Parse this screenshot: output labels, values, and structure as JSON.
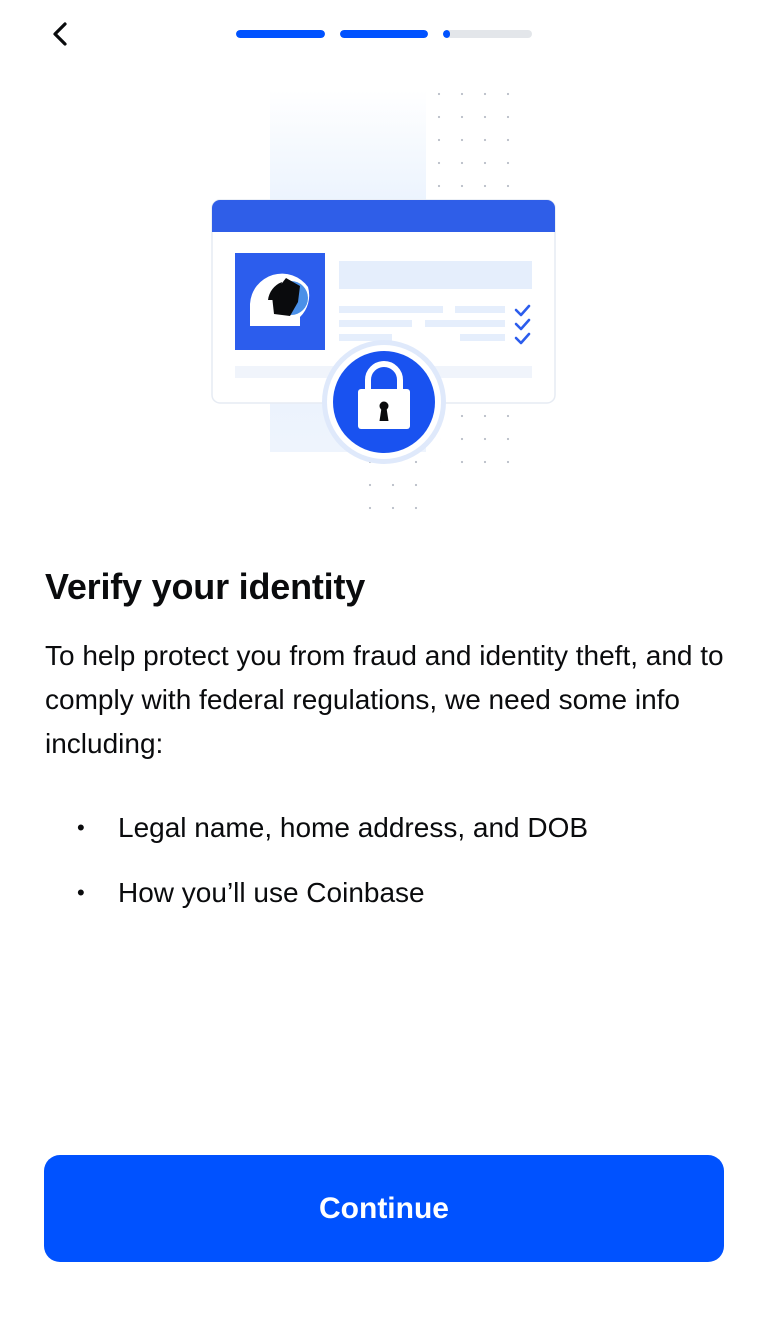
{
  "header": {
    "back_icon": "chevron-left-icon",
    "progress": [
      {
        "step": 1,
        "fill": 1.0
      },
      {
        "step": 2,
        "fill": 1.0
      },
      {
        "step": 3,
        "fill": 0.08
      }
    ]
  },
  "illustration": {
    "icons": [
      "id-card-icon",
      "profile-avatar-icon",
      "checkmark-icon",
      "padlock-icon"
    ],
    "colors": {
      "accent": "#0052ff",
      "light": "#e6f0fd",
      "ring": "#dfe9fb"
    }
  },
  "main": {
    "title": "Verify your identity",
    "description": "To help protect you from fraud and identity theft, and to comply with federal regulations, we need some info including:",
    "requirements": [
      "Legal name, home address, and DOB",
      "How you’ll use Coinbase"
    ]
  },
  "footer": {
    "continue_label": "Continue"
  },
  "colors": {
    "primary": "#0052ff",
    "text": "#0a0b0d",
    "progress_track": "#e3e6ea"
  }
}
